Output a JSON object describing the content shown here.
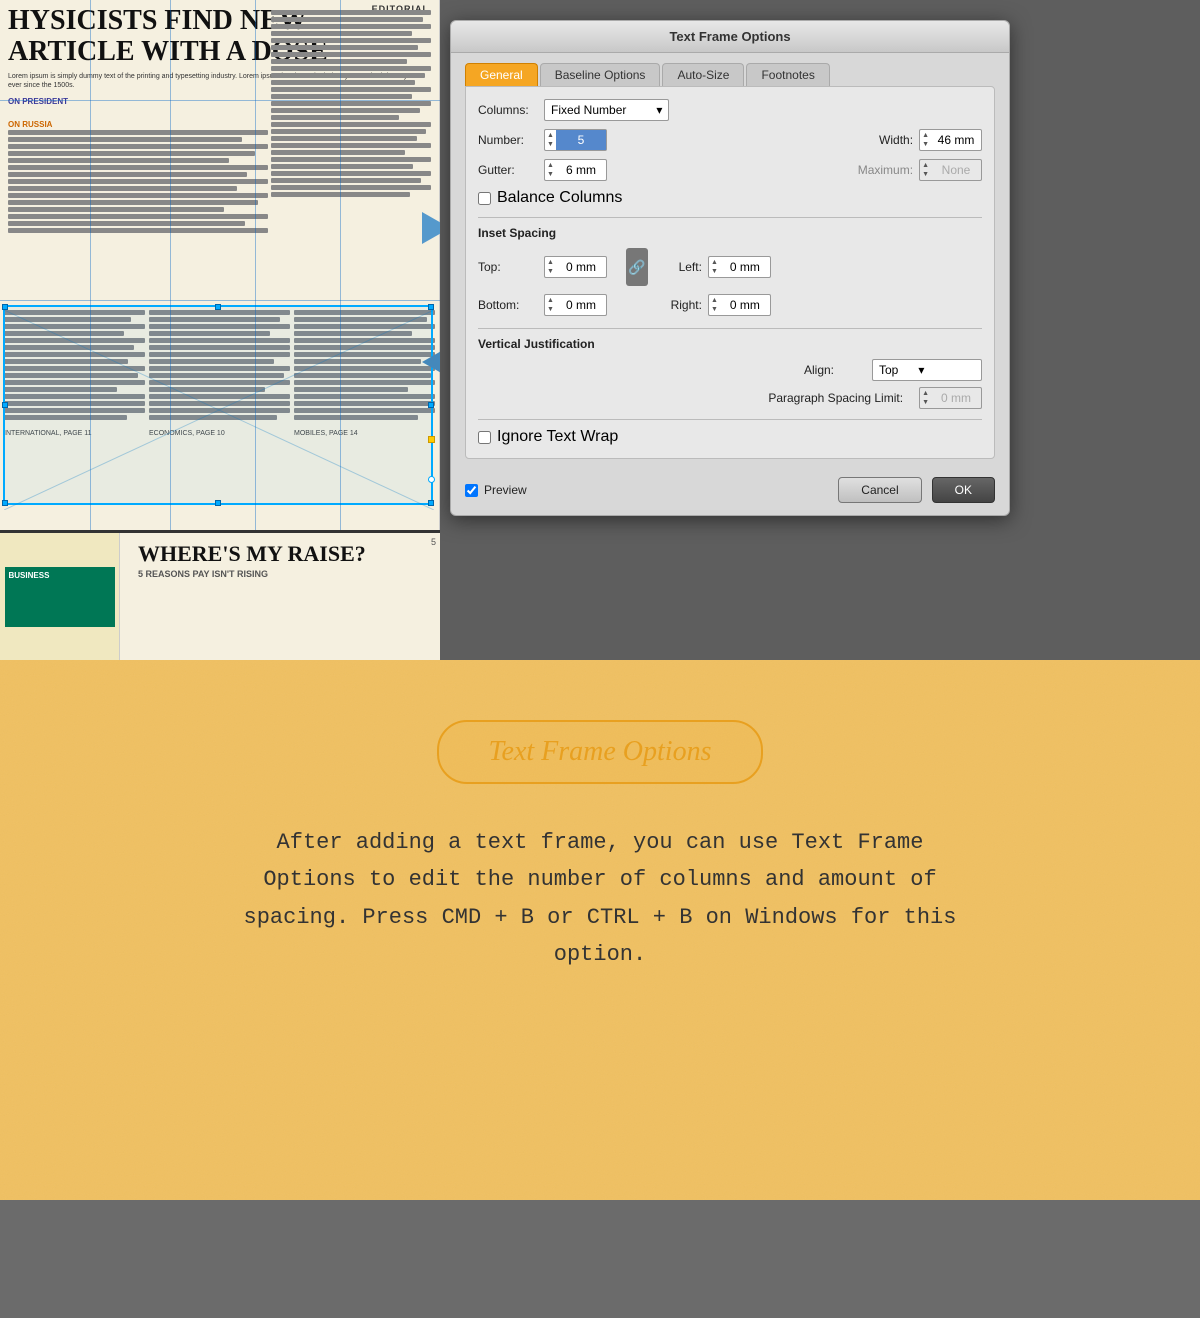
{
  "dialog": {
    "title": "Text Frame Options",
    "tabs": [
      "General",
      "Baseline Options",
      "Auto-Size",
      "Footnotes"
    ],
    "active_tab": "General",
    "columns_label": "Columns:",
    "columns_value": "Fixed Number",
    "number_label": "Number:",
    "number_value": "5",
    "width_label": "Width:",
    "width_value": "46 mm",
    "gutter_label": "Gutter:",
    "gutter_value": "6 mm",
    "maximum_label": "Maximum:",
    "maximum_value": "None",
    "balance_columns_label": "Balance Columns",
    "inset_spacing_label": "Inset Spacing",
    "top_label": "Top:",
    "top_value": "0 mm",
    "left_label": "Left:",
    "left_value": "0 mm",
    "bottom_label": "Bottom:",
    "bottom_value": "0 mm",
    "right_label": "Right:",
    "right_value": "0 mm",
    "vertical_justification_label": "Vertical Justification",
    "align_label": "Align:",
    "align_value": "Top",
    "psl_label": "Paragraph Spacing Limit:",
    "psl_value": "0 mm",
    "ignore_wrap_label": "Ignore Text Wrap",
    "preview_label": "Preview",
    "cancel_label": "Cancel",
    "ok_label": "OK"
  },
  "newspaper": {
    "title": "HYSICISTS FIND NEW ARTICLE WITH A DOSE",
    "editorial_label": "EDITORIAL",
    "on_president": "ON PRESIDENT",
    "on_russia": "ON RUSSIA",
    "bottom_label": "BUSINESS",
    "bottom_headline": "WHERE'S MY RAISE?",
    "bottom_subhead": "5 REASONS PAY ISN'T RISING",
    "page_num": "5"
  },
  "bottom": {
    "badge_text": "Text Frame Options",
    "description": "After adding a text frame, you can use Text Frame Options to edit the number of columns and amount of spacing. Press CMD + B or CTRL + B on Windows for this option."
  },
  "arrows": {
    "right_arrow_unicode": "→",
    "left_arrow_unicode": "←"
  }
}
